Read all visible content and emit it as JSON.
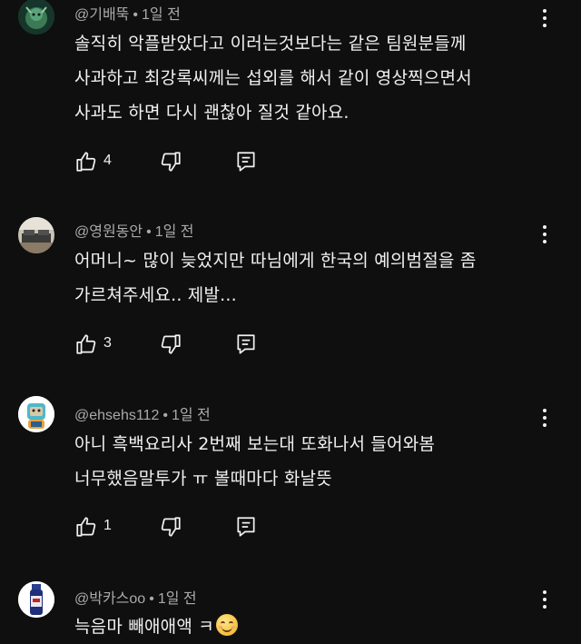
{
  "comments": [
    {
      "author": "@기배뚝",
      "time": "1일 전",
      "text_lines": [
        "솔직히 악플받았다고 이러는것보다는 같은 팀원분들께",
        "사과하고 최강록씨께는 섭외를 해서 같이 영상찍으면서",
        "사과도 하면 다시 괜찮아 질것 같아요."
      ],
      "likes": "4"
    },
    {
      "author": "@영원동안",
      "time": "1일 전",
      "text_lines": [
        "어머니~ 많이 늦었지만 따님에게 한국의 예의범절을 좀",
        "가르쳐주세요.. 제발..."
      ],
      "likes": "3"
    },
    {
      "author": "@ehsehs112",
      "time": "1일 전",
      "text_lines": [
        "아니 흑백요리사 2번째 보는대 또화나서 들어와봄",
        "너무했음말투가 ㅠ 볼때마다 화날뜻"
      ],
      "likes": "1"
    },
    {
      "author": "@박카스oo",
      "time": "1일 전",
      "text_lines": [
        "늑음마 빼애애액 ㅋ"
      ],
      "likes": ""
    }
  ],
  "separator": "•",
  "icons": {
    "like": "thumb-up-icon",
    "dislike": "thumb-down-icon",
    "reply": "reply-comment-icon",
    "more": "more-vert-icon",
    "emoji": "smiling-face-emoji"
  },
  "colors": {
    "background": "#0f0f0f",
    "text": "#f1f1f1",
    "meta": "#aaaaaa"
  }
}
